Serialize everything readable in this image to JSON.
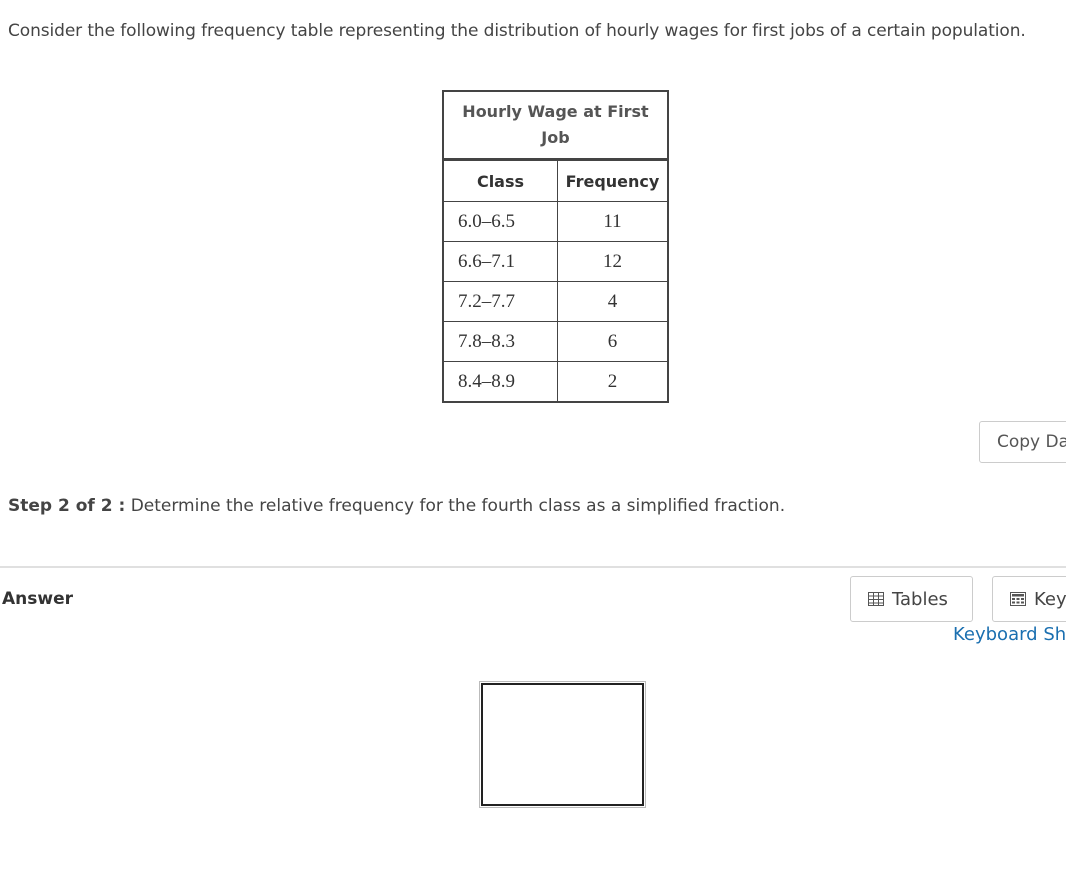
{
  "question": {
    "intro": "Consider the following frequency table representing the distribution of hourly wages for first jobs of a certain population."
  },
  "table": {
    "title_line1": "Hourly Wage at First",
    "title_line2": "Job",
    "headers": {
      "class": "Class",
      "frequency": "Frequency"
    },
    "rows": [
      {
        "class": "6.0–6.5",
        "frequency": "11"
      },
      {
        "class": "6.6–7.1",
        "frequency": "12"
      },
      {
        "class": "7.2–7.7",
        "frequency": "4"
      },
      {
        "class": "7.8–8.3",
        "frequency": "6"
      },
      {
        "class": "8.4–8.9",
        "frequency": "2"
      }
    ]
  },
  "copy_button": {
    "label": "Copy Da"
  },
  "step": {
    "label": "Step 2 of 2 :",
    "text": "Determine the relative frequency for the fourth class as a simplified fraction."
  },
  "answer": {
    "label": "Answer",
    "tables_button": "Tables",
    "keypad_button": "Key",
    "keyboard_link": "Keyboard Sho",
    "icons": {
      "tables": "table-grid-icon",
      "keypad": "keypad-icon"
    }
  }
}
